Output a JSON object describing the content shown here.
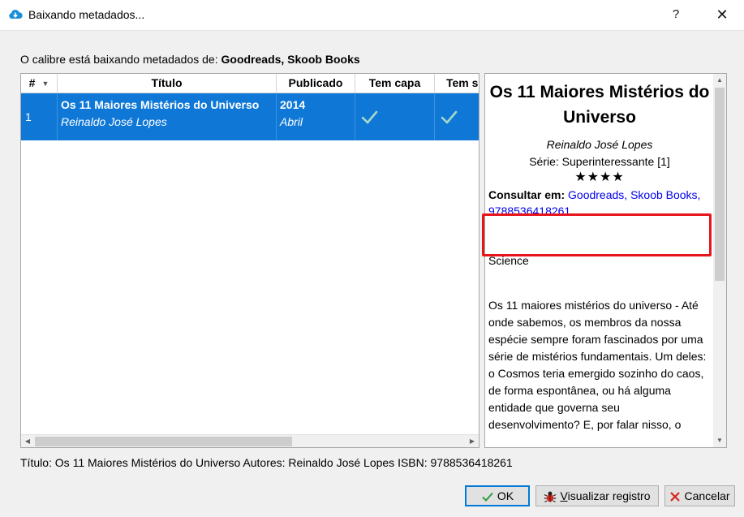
{
  "window": {
    "title": "Baixando metadados...",
    "help_label": "?",
    "close_label": "✕"
  },
  "status": {
    "prefix": "O calibre está baixando metadados de:",
    "sources": "Goodreads, Skoob Books"
  },
  "table": {
    "columns": [
      {
        "key": "num",
        "label": "#"
      },
      {
        "key": "title",
        "label": "Título"
      },
      {
        "key": "published",
        "label": "Publicado"
      },
      {
        "key": "has_cover",
        "label": "Tem capa"
      },
      {
        "key": "has_summary",
        "label": "Tem s"
      }
    ],
    "rows": [
      {
        "num": "1",
        "title": "Os 11 Maiores Mistérios do Universo",
        "author": "Reinaldo José Lopes",
        "year": "2014",
        "publisher": "Abril",
        "has_cover": true,
        "has_summary": true
      }
    ]
  },
  "preview": {
    "title": "Os 11 Maiores Mistérios do Universo",
    "author": "Reinaldo José Lopes",
    "series": "Série: Superinteressante [1]",
    "stars": "★★★★",
    "consult_label": "Consultar em:",
    "consult_links": "Goodreads, Skoob Books, 9788536418261",
    "tag": "Science",
    "description": "Os 11 maiores mistérios do universo - Até onde sabemos, os membros da nossa espécie sempre foram fascinados por uma série de mistérios fundamentais. Um deles: o Cosmos teria emergido sozinho do caos, de forma espontânea, ou há alguma entidade que governa seu desenvolvimento? E, por falar nisso, o"
  },
  "summary": "Título: Os 11 Maiores Mistérios do Universo Autores: Reinaldo José Lopes ISBN: 9788536418261",
  "buttons": {
    "ok": "OK",
    "log_underlined": "V",
    "log_rest": "isualizar registro",
    "cancel": "Cancelar"
  },
  "colors": {
    "selection": "#0f78d7",
    "link": "#0000ee",
    "highlight": "#e8141c"
  }
}
